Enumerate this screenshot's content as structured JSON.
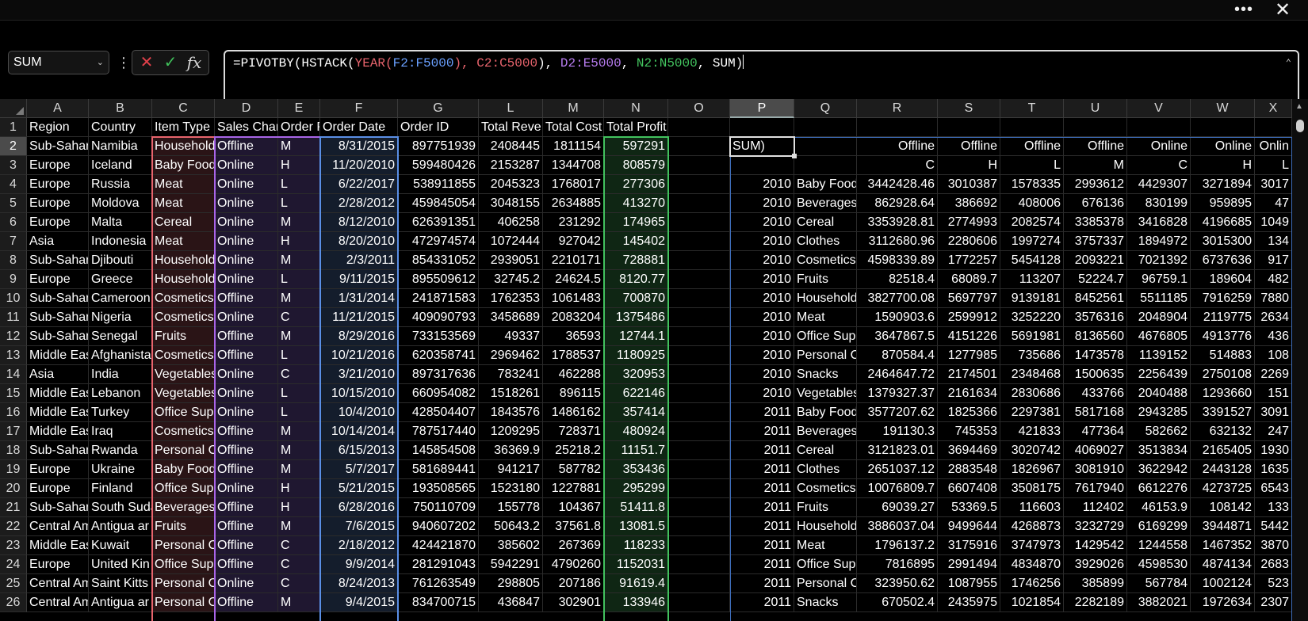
{
  "window": {
    "more_icon": "more-horizontal-icon",
    "close_icon": "close-icon"
  },
  "formula_bar": {
    "name_box": "SUM",
    "fx_label": "fx",
    "formula_parts": [
      {
        "text": "=PIVOTBY(HSTACK(",
        "color": "#ffffff"
      },
      {
        "text": "YEAR(",
        "color": "#e8646d"
      },
      {
        "text": "F2:F5000",
        "color": "#6aa0ff"
      },
      {
        "text": "), ",
        "color": "#e8646d"
      },
      {
        "text": "C2:C5000",
        "color": "#e8646d"
      },
      {
        "text": "), ",
        "color": "#ffffff"
      },
      {
        "text": "D2:E5000",
        "color": "#b77cf0"
      },
      {
        "text": ", ",
        "color": "#ffffff"
      },
      {
        "text": "N2:N5000",
        "color": "#42c25e"
      },
      {
        "text": ", SUM)",
        "color": "#ffffff"
      }
    ]
  },
  "column_headers": [
    "A",
    "B",
    "C",
    "D",
    "E",
    "F",
    "G",
    "L",
    "M",
    "N",
    "O",
    "P",
    "Q",
    "R",
    "S",
    "T",
    "U",
    "V",
    "W",
    "X"
  ],
  "selected_column": "P",
  "selected_row": 2,
  "row_numbers": [
    1,
    2,
    3,
    4,
    5,
    6,
    7,
    8,
    9,
    10,
    11,
    12,
    13,
    14,
    15,
    16,
    17,
    18,
    19,
    20,
    21,
    22,
    23,
    24,
    25,
    26
  ],
  "rows": [
    [
      "Region",
      "Country",
      "Item Type",
      "Sales Chan",
      "Order P",
      "Order Date",
      "Order ID",
      "Total Reve",
      "Total Cost",
      "Total Profit",
      "",
      "",
      "",
      "",
      "",
      "",
      "",
      "",
      "",
      ""
    ],
    [
      "Sub-Sahara",
      "Namibia",
      "Household",
      "Offline",
      "M",
      "8/31/2015",
      "897751939",
      "2408445",
      "1811154",
      "597291",
      "",
      "SUM)",
      "",
      "Offline",
      "Offline",
      "Offline",
      "Offline",
      "Online",
      "Online",
      "Onlin"
    ],
    [
      "Europe",
      "Iceland",
      "Baby Food",
      "Online",
      "H",
      "11/20/2010",
      "599480426",
      "2153287",
      "1344708",
      "808579",
      "",
      "",
      "",
      "C",
      "H",
      "L",
      "M",
      "C",
      "H",
      "L"
    ],
    [
      "Europe",
      "Russia",
      "Meat",
      "Online",
      "L",
      "6/22/2017",
      "538911855",
      "2045323",
      "1768017",
      "277306",
      "",
      "2010",
      "Baby Food",
      "3442428.46",
      "3010387",
      "1578335",
      "2993612",
      "4429307",
      "3271894",
      "3017"
    ],
    [
      "Europe",
      "Moldova",
      "Meat",
      "Online",
      "L",
      "2/28/2012",
      "459845054",
      "3048155",
      "2634885",
      "413270",
      "",
      "2010",
      "Beverages",
      "862928.64",
      "386692",
      "408006",
      "676136",
      "830199",
      "959895",
      "47"
    ],
    [
      "Europe",
      "Malta",
      "Cereal",
      "Online",
      "M",
      "8/12/2010",
      "626391351",
      "406258",
      "231292",
      "174965",
      "",
      "2010",
      "Cereal",
      "3353928.81",
      "2774993",
      "2082574",
      "3385378",
      "3416828",
      "4196685",
      "1049"
    ],
    [
      "Asia",
      "Indonesia",
      "Meat",
      "Online",
      "H",
      "8/20/2010",
      "472974574",
      "1072444",
      "927042",
      "145402",
      "",
      "2010",
      "Clothes",
      "3112680.96",
      "2280606",
      "1997274",
      "3757337",
      "1894972",
      "3015300",
      "134"
    ],
    [
      "Sub-Sahara",
      "Djibouti",
      "Household",
      "Online",
      "M",
      "2/3/2011",
      "854331052",
      "2939051",
      "2210171",
      "728881",
      "",
      "2010",
      "Cosmetics",
      "4598339.89",
      "1772257",
      "5454128",
      "2093221",
      "7021392",
      "6737636",
      "917"
    ],
    [
      "Europe",
      "Greece",
      "Household",
      "Online",
      "L",
      "9/11/2015",
      "895509612",
      "32745.2",
      "24624.5",
      "8120.77",
      "",
      "2010",
      "Fruits",
      "82518.4",
      "68089.7",
      "113207",
      "52224.7",
      "96759.1",
      "189604",
      "482"
    ],
    [
      "Sub-Sahara",
      "Cameroon",
      "Cosmetics",
      "Offline",
      "M",
      "1/31/2014",
      "241871583",
      "1762353",
      "1061483",
      "700870",
      "",
      "2010",
      "Household",
      "3827700.08",
      "5697797",
      "9139181",
      "8452561",
      "5511185",
      "7916259",
      "7880"
    ],
    [
      "Sub-Sahara",
      "Nigeria",
      "Cosmetics",
      "Online",
      "C",
      "11/21/2015",
      "409090793",
      "3458689",
      "2083204",
      "1375486",
      "",
      "2010",
      "Meat",
      "1590903.6",
      "2599912",
      "3252220",
      "3576316",
      "2048904",
      "2119775",
      "2634"
    ],
    [
      "Sub-Sahara",
      "Senegal",
      "Fruits",
      "Offline",
      "M",
      "8/29/2016",
      "733153569",
      "49337",
      "36593",
      "12744.1",
      "",
      "2010",
      "Office Sup",
      "3647867.5",
      "4151226",
      "5691981",
      "8136560",
      "4676805",
      "4913776",
      "436"
    ],
    [
      "Middle East",
      "Afghanistan",
      "Cosmetics",
      "Offline",
      "L",
      "10/21/2016",
      "620358741",
      "2969462",
      "1788537",
      "1180925",
      "",
      "2010",
      "Personal C",
      "870584.4",
      "1277985",
      "735686",
      "1473578",
      "1139152",
      "514883",
      "108"
    ],
    [
      "Asia",
      "India",
      "Vegetables",
      "Online",
      "C",
      "3/21/2010",
      "897317636",
      "783241",
      "462288",
      "320953",
      "",
      "2010",
      "Snacks",
      "2464647.72",
      "2174501",
      "2348468",
      "1500635",
      "2256439",
      "2750108",
      "2269"
    ],
    [
      "Middle East",
      "Lebanon",
      "Vegetables",
      "Online",
      "L",
      "10/15/2010",
      "660954082",
      "1518261",
      "896115",
      "622146",
      "",
      "2010",
      "Vegetables",
      "1379327.37",
      "2161634",
      "2830686",
      "433766",
      "2040488",
      "1293660",
      "151"
    ],
    [
      "Middle East",
      "Turkey",
      "Office Sup",
      "Online",
      "L",
      "10/4/2010",
      "428504407",
      "1843576",
      "1486162",
      "357414",
      "",
      "2011",
      "Baby Food",
      "3577207.62",
      "1825366",
      "2297381",
      "5817168",
      "2943285",
      "3391527",
      "3091"
    ],
    [
      "Middle East",
      "Iraq",
      "Cosmetics",
      "Offline",
      "M",
      "10/14/2014",
      "787517440",
      "1209295",
      "728371",
      "480924",
      "",
      "2011",
      "Beverages",
      "191130.3",
      "745353",
      "421833",
      "477364",
      "582662",
      "632132",
      "247"
    ],
    [
      "Sub-Sahara",
      "Rwanda",
      "Personal C",
      "Offline",
      "M",
      "6/15/2013",
      "145854508",
      "36369.9",
      "25218.2",
      "11151.7",
      "",
      "2011",
      "Cereal",
      "3121823.01",
      "3694469",
      "3020742",
      "4069027",
      "3513834",
      "2165405",
      "1930"
    ],
    [
      "Europe",
      "Ukraine",
      "Baby Food",
      "Offline",
      "M",
      "5/7/2017",
      "581689441",
      "941217",
      "587782",
      "353436",
      "",
      "2011",
      "Clothes",
      "2651037.12",
      "2883548",
      "1826967",
      "3081910",
      "3622942",
      "2443128",
      "1635"
    ],
    [
      "Europe",
      "Finland",
      "Office Sup",
      "Online",
      "H",
      "5/21/2015",
      "193508565",
      "1523180",
      "1227881",
      "295299",
      "",
      "2011",
      "Cosmetics",
      "10076809.7",
      "6607408",
      "3508175",
      "7617940",
      "6612276",
      "4273725",
      "6543"
    ],
    [
      "Sub-Sahara",
      "South Sudan",
      "Beverages",
      "Offline",
      "H",
      "6/28/2016",
      "750110709",
      "155778",
      "104367",
      "51411.8",
      "",
      "2011",
      "Fruits",
      "69039.27",
      "53369.5",
      "116603",
      "112402",
      "46153.9",
      "108142",
      "133"
    ],
    [
      "Central Am",
      "Antigua ar",
      "Fruits",
      "Offline",
      "M",
      "7/6/2015",
      "940607202",
      "50643.2",
      "37561.8",
      "13081.5",
      "",
      "2011",
      "Household",
      "3886037.04",
      "9499644",
      "4268873",
      "3232729",
      "6169299",
      "3944871",
      "5442"
    ],
    [
      "Middle East",
      "Kuwait",
      "Personal C",
      "Offline",
      "C",
      "2/18/2012",
      "424421870",
      "385602",
      "267369",
      "118233",
      "",
      "2011",
      "Meat",
      "1796137.2",
      "3175916",
      "3747973",
      "1429542",
      "1244558",
      "1467352",
      "3870"
    ],
    [
      "Europe",
      "United Kin",
      "Office Sup",
      "Offline",
      "C",
      "9/9/2014",
      "281291043",
      "5942291",
      "4790260",
      "1152031",
      "",
      "2011",
      "Office Sup",
      "7816895",
      "2991494",
      "4834870",
      "3929026",
      "4598530",
      "4874134",
      "2683"
    ],
    [
      "Central Am",
      "Saint Kitts",
      "Personal C",
      "Online",
      "C",
      "8/24/2013",
      "761263549",
      "298805",
      "207186",
      "91619.4",
      "",
      "2011",
      "Personal C",
      "323950.62",
      "1087955",
      "1746256",
      "385899",
      "567784",
      "1002124",
      "523"
    ],
    [
      "Central Am",
      "Antigua ar",
      "Personal C",
      "Offline",
      "M",
      "9/4/2015",
      "834700715",
      "436847",
      "302901",
      "133946",
      "",
      "2011",
      "Snacks",
      "670502.4",
      "2435975",
      "1021854",
      "2282189",
      "3882021",
      "1972634",
      "2307"
    ]
  ]
}
